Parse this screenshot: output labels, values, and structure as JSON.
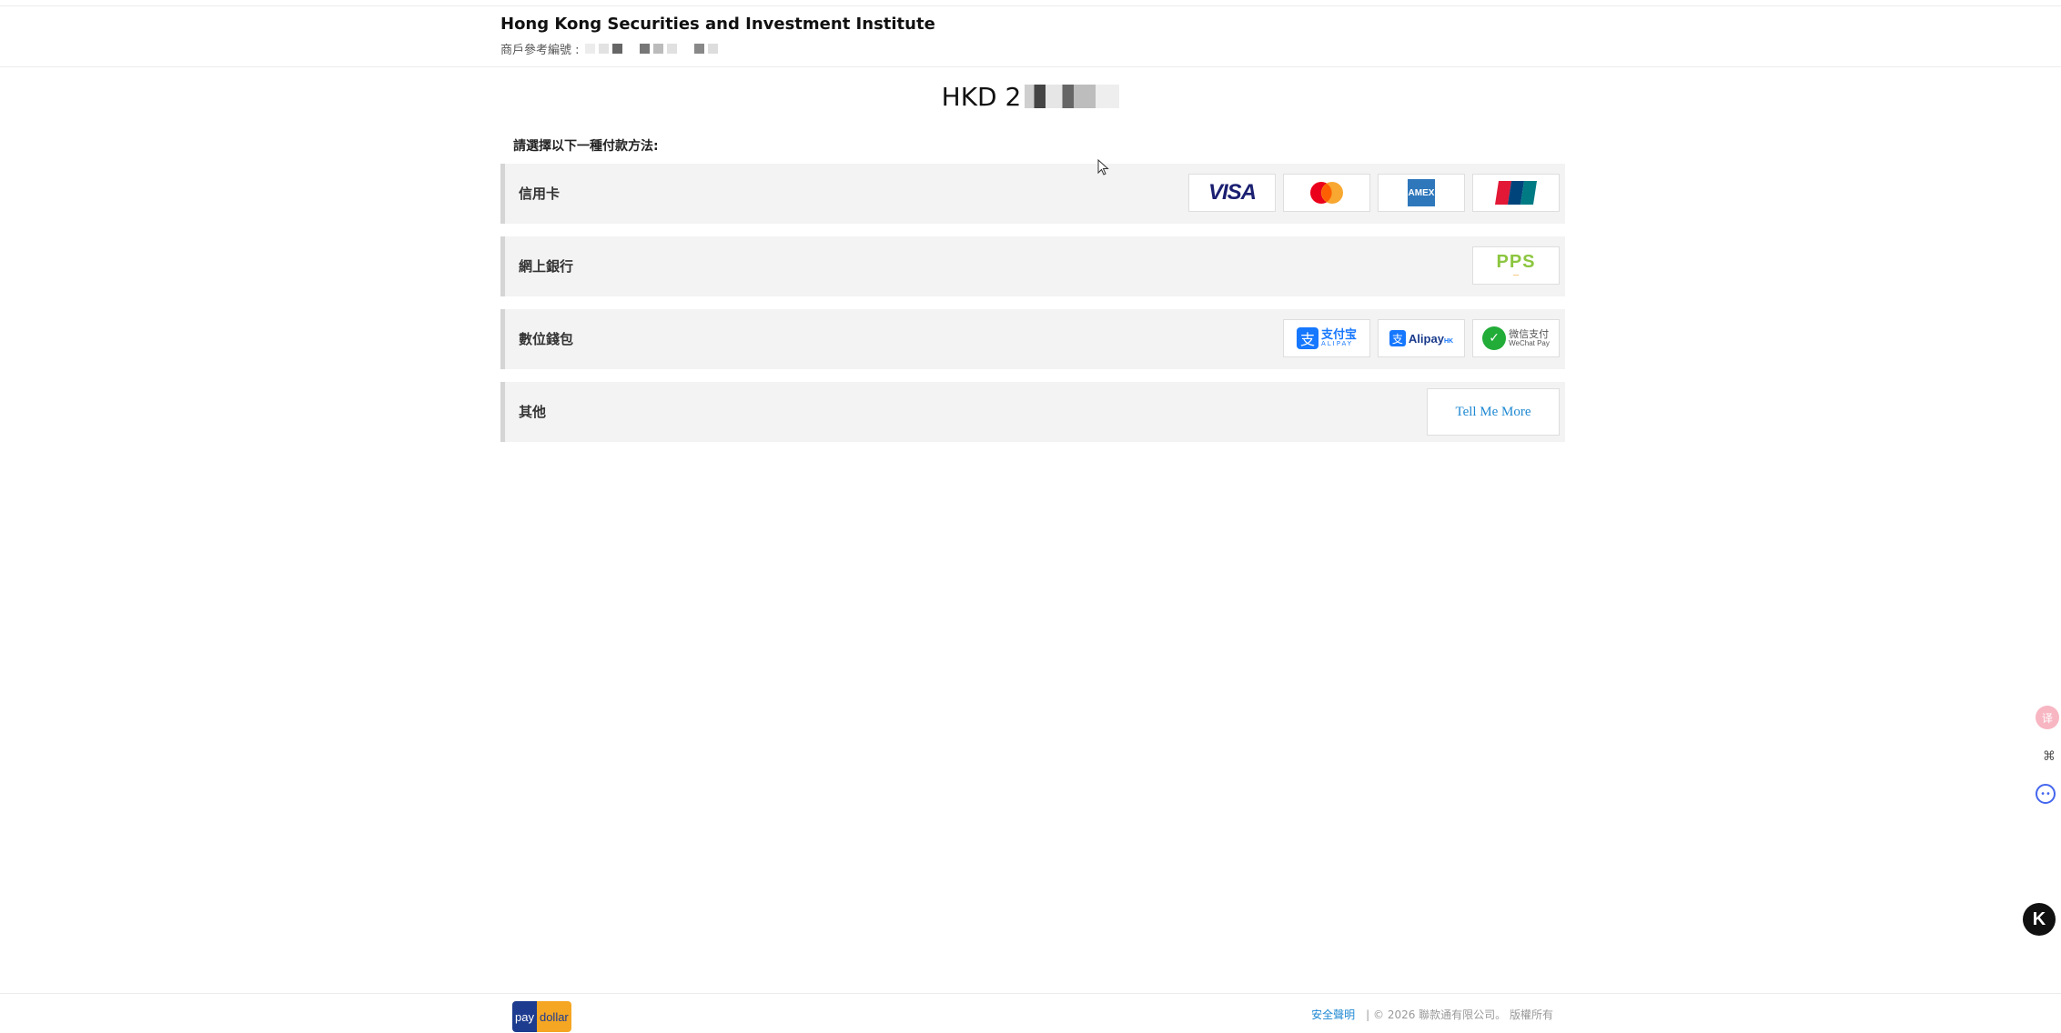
{
  "header": {
    "merchant_name": "Hong Kong Securities and Investment Institute",
    "ref_label": "商戶參考編號 :"
  },
  "amount": {
    "currency_prefix": "HKD 2",
    "value_suffix": ""
  },
  "prompt": "請選擇以下一種付款方法:",
  "methods": [
    {
      "label": "信用卡",
      "logos": [
        "VISA",
        "Mastercard",
        "AMEX",
        "UnionPay"
      ]
    },
    {
      "label": "網上銀行",
      "logos": [
        "PPS"
      ]
    },
    {
      "label": "數位錢包",
      "logos": [
        "支付宝",
        "ALIPAY",
        "Alipay",
        "HK",
        "微信支付",
        "WeChat Pay"
      ]
    },
    {
      "label": "其他",
      "button": "Tell Me More"
    }
  ],
  "footer": {
    "brand_pay": "pay",
    "brand_dollar": "dollar",
    "security_link": "安全聲明",
    "copyright": "| © 2026 聯款通有限公司。 版權所有"
  },
  "side_tools": {
    "k_label": "K"
  },
  "colors": {
    "link": "#1e88d2",
    "row_bg": "#f3f3f3",
    "visa": "#1a1f71",
    "alipay": "#1677ff",
    "wechat": "#22ac38",
    "pps": "#8cc63f"
  }
}
